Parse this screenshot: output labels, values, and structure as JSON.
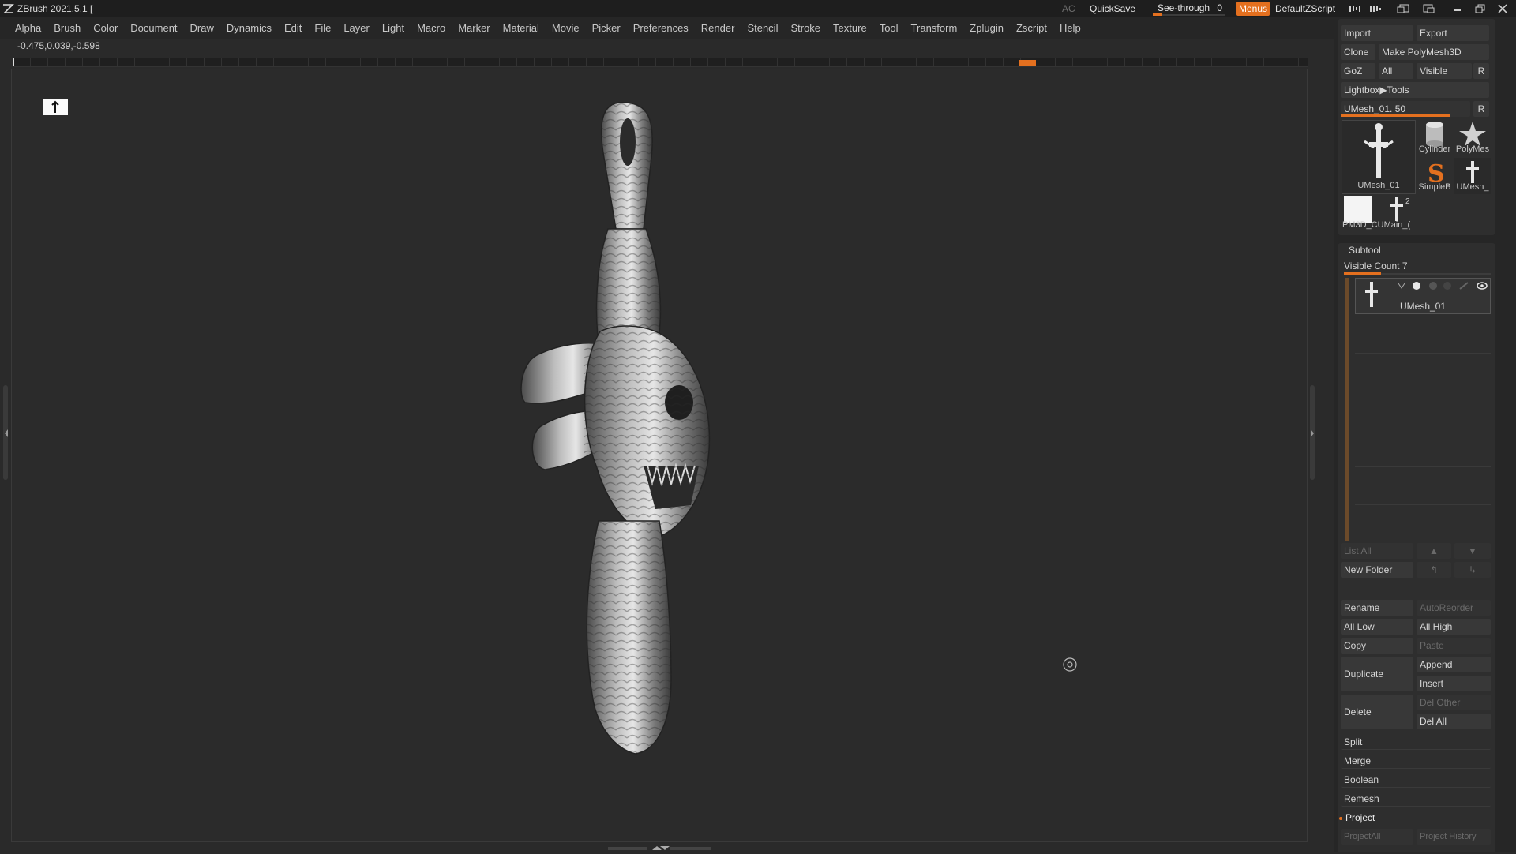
{
  "app": {
    "title": "ZBrush 2021.5.1 [",
    "logo_icon": "zbrush-logo-icon"
  },
  "titlebar": {
    "ac_label": "AC",
    "quicksave_label": "QuickSave",
    "seethrough_label": "See-through",
    "seethrough_value": "0",
    "menus_label": "Menus",
    "zscript_label": "DefaultZScript",
    "icons": [
      "brush-size-decrease-icon",
      "brush-size-increase-icon",
      "layout-switch-icon",
      "layout-restore-icon",
      "minimize-icon",
      "maximize-icon",
      "close-icon"
    ]
  },
  "menubar": {
    "items": [
      "Alpha",
      "Brush",
      "Color",
      "Document",
      "Draw",
      "Dynamics",
      "Edit",
      "File",
      "Layer",
      "Light",
      "Macro",
      "Marker",
      "Material",
      "Movie",
      "Picker",
      "Preferences",
      "Render",
      "Stencil",
      "Stroke",
      "Texture",
      "Tool",
      "Transform",
      "Zplugin",
      "Zscript",
      "Help"
    ]
  },
  "status": {
    "coordinates": "-0.475,0.039,-0.598"
  },
  "colors": {
    "accent": "#e4701f",
    "panel_bg": "#262626",
    "button_bg": "#383838",
    "viewport_bg": "#2b2b2b"
  },
  "tool_panel": {
    "import": "Import",
    "export": "Export",
    "clone": "Clone",
    "make_polymesh": "Make PolyMesh3D",
    "goz": "GoZ",
    "all": "All",
    "visible": "Visible",
    "r": "R",
    "lightbox_tools": "Lightbox▶Tools",
    "current_tool_label": "UMesh_01. 50",
    "current_tool_slider": 0.84,
    "thumbnails": [
      {
        "label": "UMesh_01",
        "icon": "umesh-cross-thumbnail-icon"
      },
      {
        "label": "Cylinder",
        "icon": "cylinder-thumbnail-icon"
      },
      {
        "label": "PolyMes",
        "icon": "polymesh-star-thumbnail-icon"
      },
      {
        "label": "SimpleB",
        "icon": "simplebrush-s-thumbnail-icon"
      },
      {
        "label": "UMesh_",
        "icon": "umesh-small-thumbnail-icon"
      },
      {
        "label": "PM3D_CUMain_(",
        "icon": "pm3d-thumbnail-icon"
      },
      {
        "label": "2",
        "icon": "count-badge"
      }
    ]
  },
  "subtool": {
    "header": "Subtool",
    "visible_count_label": "Visible Count 7",
    "visible_count_slider": 0.25,
    "items": [
      {
        "name": "UMesh_01"
      }
    ],
    "list_all": "List All",
    "new_folder": "New Folder",
    "rename": "Rename",
    "auto_reorder": "AutoReorder",
    "all_low": "All Low",
    "all_high": "All High",
    "copy": "Copy",
    "paste": "Paste",
    "duplicate": "Duplicate",
    "append": "Append",
    "insert": "Insert",
    "delete": "Delete",
    "del_other": "Del Other",
    "del_all": "Del All",
    "split": "Split",
    "merge": "Merge",
    "boolean": "Boolean",
    "remesh": "Remesh",
    "project": "Project",
    "project_all": "ProjectAll",
    "project_history": "Project History"
  }
}
